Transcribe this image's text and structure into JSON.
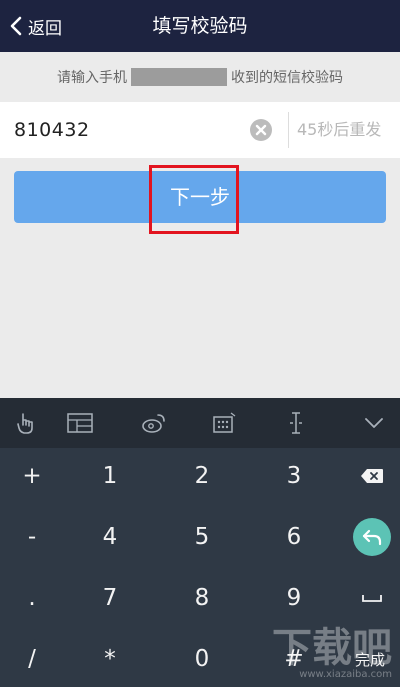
{
  "nav": {
    "back_label": "返回",
    "title": "填写校验码"
  },
  "hint": {
    "prefix": "请输入手机",
    "suffix": "收到的短信校验码"
  },
  "code_input": {
    "value": "810432",
    "resend_label": "45秒后重发"
  },
  "next_button": {
    "label": "下一步"
  },
  "keyboard": {
    "keys": {
      "plus": "+",
      "minus": "-",
      "dot": ".",
      "slash": "/",
      "k1": "1",
      "k2": "2",
      "k3": "3",
      "k4": "4",
      "k5": "5",
      "k6": "6",
      "k7": "7",
      "k8": "8",
      "k9": "9",
      "star": "*",
      "k0": "0",
      "hash": "#",
      "done": "完成"
    }
  },
  "watermark": {
    "text": "下载吧",
    "url": "www.xiazaiba.com"
  },
  "colors": {
    "nav_bg": "#1d2340",
    "button_bg": "#65a7ec",
    "highlight": "#e2141f",
    "keyboard_bg": "#2f3945",
    "undo_bg": "#5cc3b5"
  }
}
